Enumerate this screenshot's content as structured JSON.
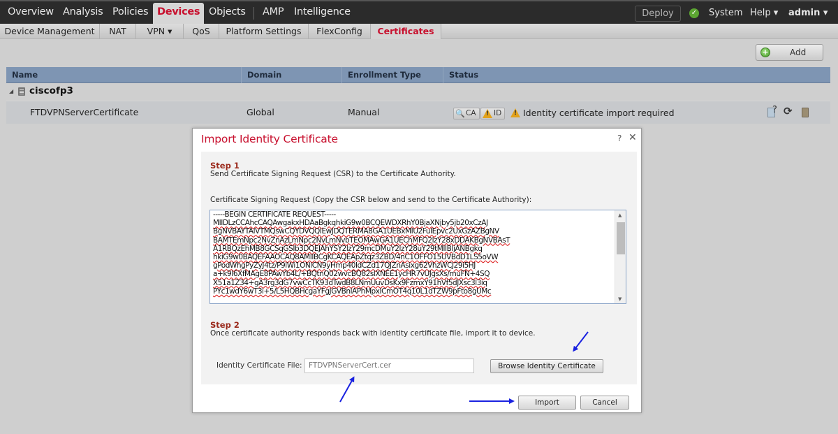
{
  "topnav": {
    "items": [
      "Overview",
      "Analysis",
      "Policies",
      "Devices",
      "Objects",
      "AMP",
      "Intelligence"
    ],
    "active": "Devices",
    "deploy_label": "Deploy",
    "system_label": "System",
    "help_label": "Help ▾",
    "user_label": "admin ▾"
  },
  "subnav": {
    "tabs": [
      "Device Management",
      "NAT",
      "VPN ▾",
      "QoS",
      "Platform Settings",
      "FlexConfig",
      "Certificates"
    ],
    "active": "Certificates"
  },
  "toolbar": {
    "add_label": "Add"
  },
  "table": {
    "columns": [
      "Name",
      "Domain",
      "Enrollment Type",
      "Status"
    ],
    "group": {
      "name": "ciscofp3",
      "icon": "server-icon"
    },
    "rows": [
      {
        "name": "FTDVPNServerCertificate",
        "domain": "Global",
        "enrollment_type": "Manual",
        "status": {
          "ca_badge": "CA",
          "id_badge": "ID",
          "message": "Identity certificate import required"
        }
      }
    ]
  },
  "dialog": {
    "title": "Import Identity Certificate",
    "help": "?",
    "close": "✕",
    "step1": {
      "title": "Step 1",
      "text": "Send Certificate Signing Request (CSR) to the Certificate Authority.",
      "csr_label": "Certificate Signing Request (Copy the CSR below and send to the Certificate Authority):",
      "csr_lines": [
        "-----BEGIN CERTIFICATE REQUEST-----",
        "MIIDLzCCAhcCAQAwgakxHDAaBgkqhkiG9w0BCQEWDXRhY0BjaXNjby5jb20xCzAJ",
        "BgNVBAYTAlVTMQswCQYDVQQIEwJDQTERMA8GA1UEBxMIU2FuIEpvc2UxGzAZBgNV",
        "BAMTEmNpc2NvZnAzLmNpc2NvLmNvbTEOMAwGA1UEChMFQ2lzY28xDDAKBgNVBAsT",
        "A1RBQzEhMB8GCSqGSIb3DQEJAhYSY2lzY29mcDMuY2lzY28uY29tMIIBIjANBgkq",
        "hkiG9w0BAQEFAAOCAQ8AMIIBCgKCAQEApZtqz3ZBD/4nC1OFFO15UVBdD1LS5oVW",
        "gPodWhgPyZyJ4tz/P9lWi1ONlCN9yHmp40IdCZd17QJZnAsixg62VhzWCJ29i5HJ",
        "a+k9I6XfMAgE8PAwYb4L/+BQtnQ02wvcBQ82slXNEE1ycHR7vUJgsXs/muFN+4SQ",
        "X51a1Z34+gA3rg3dG7vwCcTK93dTwdB8LNmUuvDsKx9FzmxY91hVf5dJXsc3l3iq",
        "PYc1wdY6wT3i+5/L5HQBHcgaYFgJGVBnlAPhMpxICmOT4q10L1dTZW9pFto8gUMc"
      ]
    },
    "step2": {
      "title": "Step 2",
      "text": "Once certificate authority responds back with identity certificate file, import it to device.",
      "file_label": "Identity Certificate File:",
      "file_value": "FTDVPNServerCert.cer",
      "browse_label": "Browse Identity Certificate"
    },
    "import_label": "Import",
    "cancel_label": "Cancel"
  },
  "colors": {
    "accent_red": "#c8102e",
    "step_red": "#9b2a1c",
    "header_blue": "#7e95b3",
    "annotation_arrow": "#1a22e0"
  }
}
